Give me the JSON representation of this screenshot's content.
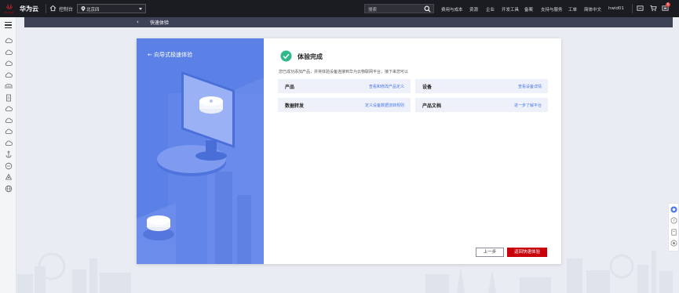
{
  "topbar": {
    "logo_text": "HUAWEI",
    "brand": "华为云",
    "console": "控制台",
    "region": "北京四",
    "search_placeholder": "搜索",
    "menu": [
      "费用与成本",
      "资源",
      "企业",
      "开发工具",
      "备案",
      "支持与服务",
      "工单",
      "简体中文",
      "hwid01"
    ],
    "notification_count": "6"
  },
  "page": {
    "back": "‹",
    "title": "快速体验"
  },
  "sidebar": {
    "icons": [
      "cloud-icon",
      "cloud-icon",
      "cloud-icon",
      "cloud-icon",
      "bridge-icon",
      "document-icon",
      "cloud-icon",
      "cloud-icon",
      "cloud-icon",
      "cloud-icon",
      "anchor-icon",
      "chat-icon",
      "network-icon",
      "globe-icon"
    ]
  },
  "modal": {
    "left_title": "向导式极速体验",
    "done_title": "体验完成",
    "description": "您已成功添加产品，并将体验设备连接到华为云物联网平台，接下来您可以",
    "cards": [
      {
        "label": "产品",
        "link": "查看和修改产品定义"
      },
      {
        "label": "设备",
        "link": "查看设备详情"
      },
      {
        "label": "数据转发",
        "link": "定义设备数据流转规则"
      },
      {
        "label": "产品文档",
        "link": "进一步了解平台"
      }
    ],
    "prev_button": "上一步",
    "return_button": "返回快速体验"
  },
  "colors": {
    "accent": "#c7000b",
    "panel_blue": "#5b80e6",
    "link": "#4a79e8",
    "success": "#2fb98a"
  }
}
